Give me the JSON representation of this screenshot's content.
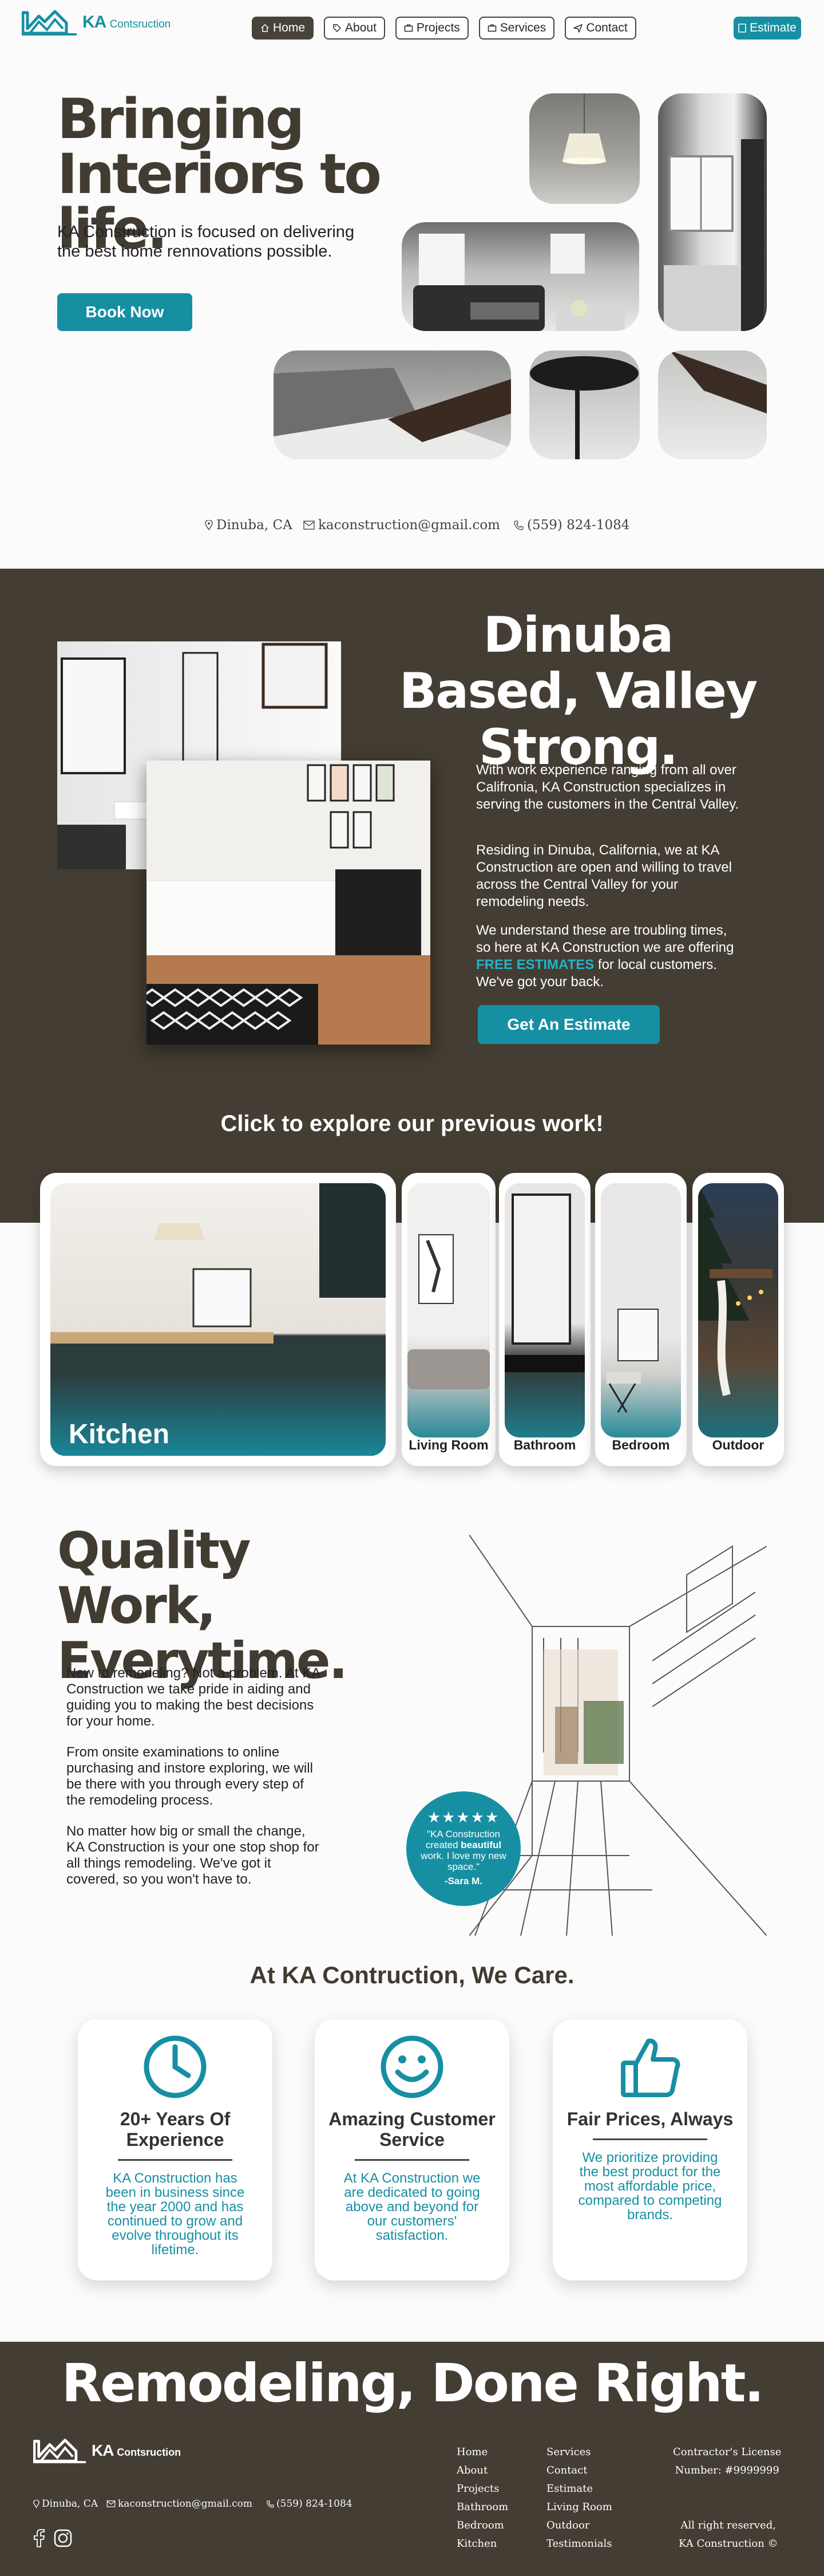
{
  "brand": {
    "name": "KA",
    "suffix": "Contsruction",
    "accent": "#178fa3",
    "dark": "#433d33"
  },
  "nav": {
    "items": [
      {
        "label": "Home",
        "icon": "home-icon"
      },
      {
        "label": "About",
        "icon": "tag-icon"
      },
      {
        "label": "Projects",
        "icon": "briefcase-icon"
      },
      {
        "label": "Services",
        "icon": "briefcase-icon"
      },
      {
        "label": "Contact",
        "icon": "send-icon"
      }
    ],
    "estimate": "Estimate"
  },
  "hero": {
    "title": "Bringing Interiors to life.",
    "subtitle": "KA Construction is focused on delivering the best home rennovations possible.",
    "cta": "Book Now"
  },
  "contact": {
    "location": "Dinuba, CA",
    "email": "kaconstruction@gmail.com",
    "phone": "(559) 824-1084"
  },
  "about": {
    "title": "Dinuba Based, Valley Strong.",
    "p1": "With work experience ranging from all over Califronia, KA Construction specializes in serving the customers in the Central Valley.",
    "p2": "Residing in Dinuba, California, we at KA Construction are open and willing to travel across the Central Valley for your remodeling needs.",
    "p3_a": "We understand these are troubling times, so here at KA Construction we are offering ",
    "p3_b": "FREE ESTIMATES",
    "p3_c": " for local customers. We've got your back.",
    "cta": "Get An Estimate",
    "explore": "Click to explore our previous work!"
  },
  "projects": [
    "Kitchen",
    "Living Room",
    "Bathroom",
    "Bedroom",
    "Outdoor"
  ],
  "quality": {
    "title": "Quality Work, Everytime.",
    "p1": "New to remodeling? Not a problem. At KA Construction we take pride in aiding and guiding you to making the best decisions for your home.",
    "p2": "From onsite examinations to online purchasing and instore exploring, we will be there with you through every step of the remodeling process.",
    "p3": "No matter how big or small the change, KA Construction is your one stop shop for all things remodeling. We've got it covered, so you won't have to.",
    "testimonial": {
      "stars": "★★★★★",
      "text_a": "\"KA Construction created ",
      "text_b": "beautiful",
      "text_c": " work. I love my new space.\"",
      "author": "-Sara M."
    }
  },
  "care": {
    "title": "At KA Contruction, We Care.",
    "cards": [
      {
        "icon": "clock-icon",
        "heading": "20+ Years Of Experience",
        "text": "KA Construction has been in business since the year 2000 and has continued to grow and evolve throughout its lifetime."
      },
      {
        "icon": "smile-icon",
        "heading": "Amazing Customer Service",
        "text": "At KA Construction we are dedicated to going above and beyond for our customers' satisfaction."
      },
      {
        "icon": "thumbs-up-icon",
        "heading": "Fair Prices, Always",
        "text": "We prioritize providing the best product for the most affordable price, compared to competing brands."
      }
    ]
  },
  "footer": {
    "tagline": "Remodeling, Done Right.",
    "col1": [
      "Home",
      "About",
      "Projects",
      "Bathroom",
      "Bedroom",
      "Kitchen"
    ],
    "col2": [
      "Services",
      "Contact",
      "Estimate",
      "Living Room",
      "Outdoor",
      "Testimonials"
    ],
    "license_1": "Contractor's License",
    "license_2": "Number: #9999999",
    "rights_1": "All right reserved,",
    "rights_2": "KA Construction ©"
  }
}
